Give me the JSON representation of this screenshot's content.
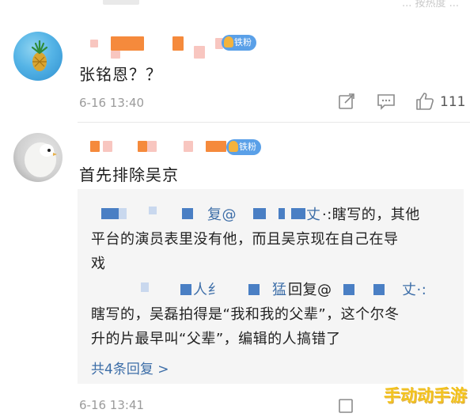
{
  "top_bar": {
    "partial_text": "... 按热度 ..."
  },
  "comments": [
    {
      "badge": "铁粉",
      "text": "张铭恩？？",
      "time": "6-16 13:40",
      "like_count": "111"
    },
    {
      "badge": "铁粉",
      "text": "首先排除吴京",
      "replies": [
        {
          "prefix": "复@",
          "mid_suffix": "丈",
          "line1_tail": "·:瞎写的，其他",
          "line2": "平台的演员表里没有他，而且吴京现在自己在导",
          "line3": "戏"
        },
        {
          "prefix_fragment": "人纟",
          "name_fragment": "猛",
          "action": "回复@",
          "suffix_fragment": "丈·:",
          "line2": "瞎写的，吴磊拍得是“我和我的父辈”，这个尔冬",
          "line3": "升的片最早叫“父辈”，编辑的人搞错了"
        }
      ],
      "more_replies": "共4条回复 >",
      "time": "6-16 13:41"
    }
  ],
  "watermark": "手动动手游",
  "colors": {
    "link": "#3d6ea8",
    "badge_gold": "#f4b33c",
    "badge_blue": "#5aa0e8",
    "orange_mosaic": "#f58a3c",
    "pink_mosaic": "#f8c6c0",
    "blue_mosaic": "#4a7fc4",
    "watermark": "#f2c21b"
  },
  "icons": [
    "share-icon",
    "comment-icon",
    "like-icon"
  ]
}
